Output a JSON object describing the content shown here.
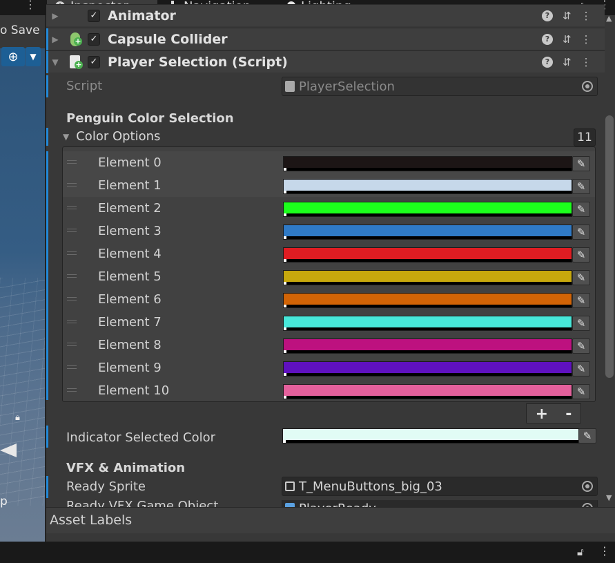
{
  "tabs": [
    {
      "label": "Inspector",
      "icon": "info-icon"
    },
    {
      "label": "Navigation",
      "icon": "navigation-icon"
    },
    {
      "label": "Lighting",
      "icon": "lightbulb-icon"
    }
  ],
  "scene": {
    "save_text": "o Save",
    "partial_text": "p"
  },
  "components": [
    {
      "title": "Animator"
    },
    {
      "title": "Capsule Collider"
    },
    {
      "title": "Player Selection (Script)"
    }
  ],
  "script_field": {
    "label": "Script",
    "value": "PlayerSelection"
  },
  "section_penguin": "Penguin Color Selection",
  "color_options": {
    "label": "Color Options",
    "count": "11",
    "elements": [
      {
        "label": "Element 0",
        "color": "#1c1515"
      },
      {
        "label": "Element 1",
        "color": "#c6d8ea"
      },
      {
        "label": "Element 2",
        "color": "#1cff1c"
      },
      {
        "label": "Element 3",
        "color": "#2f7ac6"
      },
      {
        "label": "Element 4",
        "color": "#e01c22"
      },
      {
        "label": "Element 5",
        "color": "#c7a80d"
      },
      {
        "label": "Element 6",
        "color": "#d26406"
      },
      {
        "label": "Element 7",
        "color": "#47e7d9"
      },
      {
        "label": "Element 8",
        "color": "#bd117f"
      },
      {
        "label": "Element 9",
        "color": "#5f11bf"
      },
      {
        "label": "Element 10",
        "color": "#e4609c"
      }
    ]
  },
  "list_buttons": {
    "add": "+",
    "remove": "-"
  },
  "indicator": {
    "label": "Indicator Selected Color",
    "color": "#e1fcf5"
  },
  "section_vfx": "VFX & Animation",
  "ready_sprite": {
    "label": "Ready Sprite",
    "value": "T_MenuButtons_big_03"
  },
  "ready_vfx": {
    "label": "Ready VFX Game Object",
    "value": "PlayerReady"
  },
  "asset_labels": "Asset Labels"
}
